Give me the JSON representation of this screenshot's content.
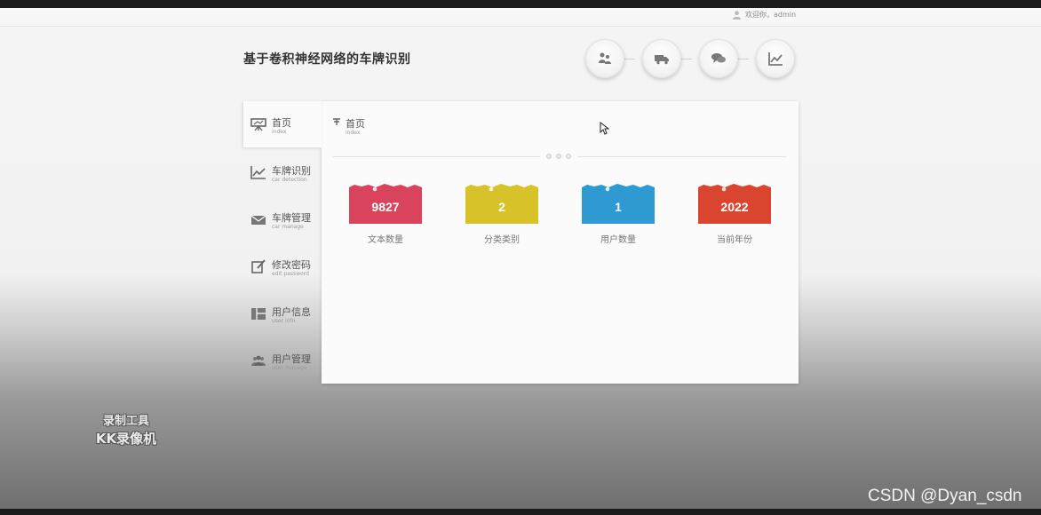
{
  "header": {
    "welcome_text": "欢迎你，admin",
    "site_title": "基于卷积神经网络的车牌识别"
  },
  "top_nav": [
    {
      "icon": "users-icon"
    },
    {
      "icon": "truck-icon"
    },
    {
      "icon": "chat-icon"
    },
    {
      "icon": "line-chart-icon"
    }
  ],
  "sidebar": {
    "items": [
      {
        "label": "首页",
        "sub": "index",
        "icon": "presentation-board-icon",
        "active": true
      },
      {
        "label": "车牌识别",
        "sub": "car detection",
        "icon": "line-chart-icon",
        "active": false
      },
      {
        "label": "车牌管理",
        "sub": "car manage",
        "icon": "envelope-icon",
        "active": false
      },
      {
        "label": "修改密码",
        "sub": "edit password",
        "icon": "edit-icon",
        "active": false
      },
      {
        "label": "用户信息",
        "sub": "user info",
        "icon": "grid-icon",
        "active": false
      },
      {
        "label": "用户管理",
        "sub": "user manage",
        "icon": "users-icon",
        "active": false
      }
    ]
  },
  "breadcrumb": {
    "label": "首页",
    "sub": "index",
    "icon": "pin-icon"
  },
  "stats": [
    {
      "value": "9827",
      "label": "文本数量",
      "color": "#d9435b"
    },
    {
      "value": "2",
      "label": "分类类别",
      "color": "#d8c22a"
    },
    {
      "value": "1",
      "label": "用户数量",
      "color": "#2e9ad1"
    },
    {
      "value": "2022",
      "label": "当前年份",
      "color": "#d9452f"
    }
  ],
  "overlay": {
    "watermark_line1": "录制工具",
    "watermark_line2": "KK录像机",
    "csdn": "CSDN @Dyan_csdn"
  }
}
